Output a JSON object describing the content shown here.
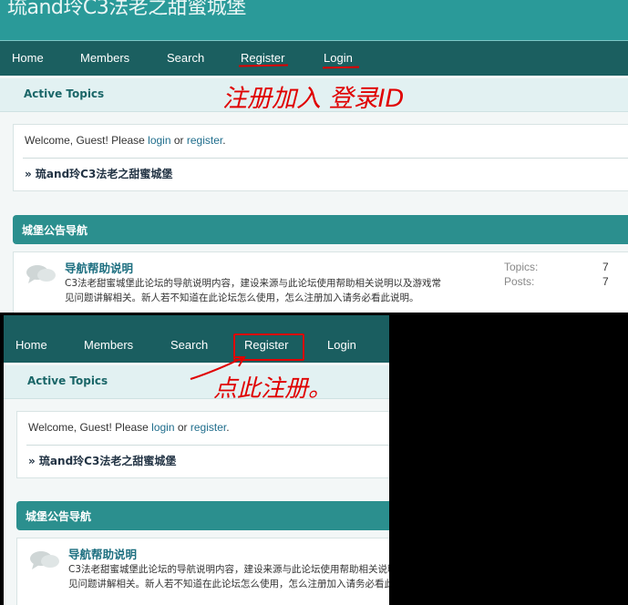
{
  "site": {
    "title": "琉and玲C3法老之甜蜜城堡"
  },
  "nav": {
    "home": "Home",
    "members": "Members",
    "search": "Search",
    "register": "Register",
    "login": "Login"
  },
  "sub": {
    "active_topics": "Active Topics"
  },
  "welcome": {
    "prefix": "Welcome, Guest!  Please ",
    "login": "login",
    "or": " or ",
    "register": "register",
    "suffix": "."
  },
  "board": {
    "link": "» 琉and玲C3法老之甜蜜城堡"
  },
  "category": {
    "title": "城堡公告导航"
  },
  "forum": {
    "name": "导航帮助说明",
    "description": "C3法老甜蜜城堡此论坛的导航说明内容，建设来源与此论坛使用帮助相关说明以及游戏常见问题讲解相关。新人若不知道在此论坛怎么使用，怎么注册加入请务必看此说明。",
    "topics_label": "Topics:",
    "topics_value": "7",
    "posts_label": "Posts:",
    "posts_value": "7"
  },
  "annotations": {
    "top_note": "注册加入 登录ID",
    "bottom_note": "点此注册。",
    "color": "#e00000"
  },
  "colors": {
    "header": "#2a9a99",
    "navbar": "#1b5f60",
    "category": "#2b8f8e",
    "accent": "#1d6f80"
  }
}
